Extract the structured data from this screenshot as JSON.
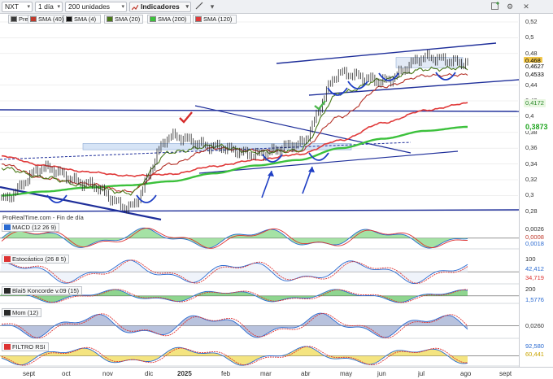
{
  "toolbar": {
    "symbol": "NXT",
    "period": "1 día",
    "units": "200 unidades",
    "indicators": "Indicadores"
  },
  "legend": [
    {
      "label": "Precio",
      "color": "#3b3b3b"
    },
    {
      "label": "SMA (40)",
      "color": "#c0392b"
    },
    {
      "label": "SMA (4)",
      "color": "#111111"
    },
    {
      "label": "SMA (20)",
      "color": "#4a7a1a"
    },
    {
      "label": "SMA (200)",
      "color": "#3cc13c"
    },
    {
      "label": "SMA (120)",
      "color": "#e03a3a"
    }
  ],
  "watermark": "ProRealTime.com - Fin de día",
  "price_axis": {
    "ticks": [
      "0,52",
      "0,5",
      "0,48",
      "0,44",
      "0,42",
      "0,4",
      "0,38",
      "0,36",
      "0,34",
      "0,32",
      "0,3",
      "0,28"
    ],
    "tags": [
      {
        "value": "0,468",
        "bg": "#f0c64a",
        "fg": "#000000"
      },
      {
        "value": "0,4627",
        "bg": "#ffffff",
        "fg": "#000000"
      },
      {
        "value": "0,4533",
        "bg": "#ffffff",
        "fg": "#000000"
      },
      {
        "value": "0,4172",
        "bg": "#e9f7e2",
        "fg": "#2d8a2d"
      },
      {
        "value": "0,3873",
        "bg": "#ffffff",
        "fg": "#1fa51f"
      }
    ]
  },
  "panels": {
    "macd": {
      "label": "MACD (12 26 9)",
      "tags": [
        "0,0026",
        "0,0008",
        "0,0018"
      ]
    },
    "stoch": {
      "label": "Estocástico (26 8 5)",
      "ticks": [
        "100"
      ],
      "tags": [
        "42,412",
        "34,719"
      ]
    },
    "blai": {
      "label": "Blai5 Koncorde v.09 (15)",
      "ticks": [
        "200"
      ],
      "tags": [
        "1,5776"
      ]
    },
    "mom": {
      "label": "Mom (12)",
      "tags": [
        "0,0260"
      ]
    },
    "rsi": {
      "label": "FILTRO RSI",
      "tags": [
        "92,580",
        "60,441"
      ]
    }
  },
  "xaxis": [
    {
      "label": "sept",
      "bold": false
    },
    {
      "label": "oct",
      "bold": false
    },
    {
      "label": "nov",
      "bold": false
    },
    {
      "label": "dic",
      "bold": false
    },
    {
      "label": "2025",
      "bold": true
    },
    {
      "label": "feb",
      "bold": false
    },
    {
      "label": "mar",
      "bold": false
    },
    {
      "label": "abr",
      "bold": false
    },
    {
      "label": "may",
      "bold": false
    },
    {
      "label": "jun",
      "bold": false
    },
    {
      "label": "jul",
      "bold": false
    },
    {
      "label": "ago",
      "bold": false
    },
    {
      "label": "sept",
      "bold": false
    }
  ],
  "colors": {
    "channel": "#1f2f9a",
    "price": "#2a2a2a",
    "sma200": "#3cc13c",
    "sma120": "#e03a3a",
    "sma40": "#b5332a",
    "sma20": "#4a7a1a",
    "arrow": "#1f3fc4"
  },
  "chart_data": {
    "type": "line",
    "title": "",
    "xlabel": "",
    "ylabel": "",
    "ylim": [
      0.27,
      0.53
    ],
    "x": [
      "2024-09-01",
      "2024-10-01",
      "2024-11-01",
      "2024-12-01",
      "2025-01-01",
      "2025-02-01",
      "2025-03-01",
      "2025-04-01",
      "2025-05-01",
      "2025-06-01",
      "2025-07-01",
      "2025-08-01"
    ],
    "series": [
      {
        "name": "Precio",
        "values": [
          0.295,
          0.335,
          0.315,
          0.285,
          0.375,
          0.362,
          0.352,
          0.365,
          0.455,
          0.445,
          0.475,
          0.468
        ]
      },
      {
        "name": "SMA (200)",
        "values": [
          0.3,
          0.305,
          0.31,
          0.313,
          0.318,
          0.328,
          0.338,
          0.345,
          0.36,
          0.372,
          0.382,
          0.387
        ]
      },
      {
        "name": "SMA (120)",
        "values": [
          0.35,
          0.338,
          0.33,
          0.325,
          0.327,
          0.337,
          0.345,
          0.352,
          0.37,
          0.392,
          0.408,
          0.417
        ]
      },
      {
        "name": "SMA (40)",
        "values": [
          0.34,
          0.322,
          0.315,
          0.305,
          0.34,
          0.36,
          0.357,
          0.356,
          0.4,
          0.438,
          0.452,
          0.453
        ]
      },
      {
        "name": "SMA (20)",
        "values": [
          0.335,
          0.323,
          0.312,
          0.303,
          0.355,
          0.363,
          0.355,
          0.357,
          0.43,
          0.447,
          0.46,
          0.462
        ]
      }
    ]
  }
}
